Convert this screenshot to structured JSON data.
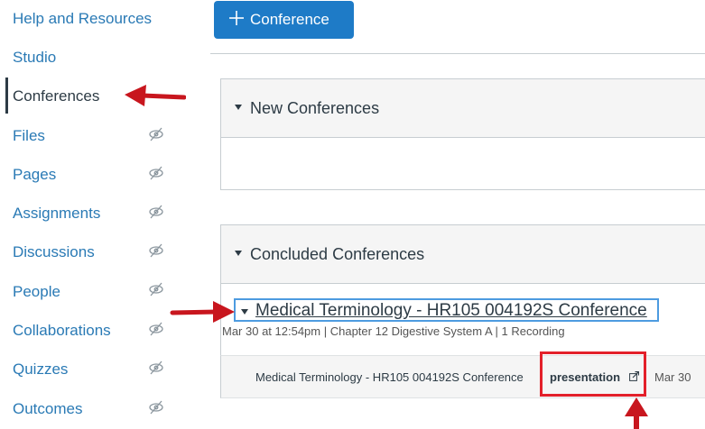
{
  "sidebar": {
    "items": [
      {
        "label": "Help and Resources",
        "hidden": false
      },
      {
        "label": "Studio",
        "hidden": false
      },
      {
        "label": "Conferences",
        "hidden": false,
        "active": true
      },
      {
        "label": "Files",
        "hidden": true
      },
      {
        "label": "Pages",
        "hidden": true
      },
      {
        "label": "Assignments",
        "hidden": true
      },
      {
        "label": "Discussions",
        "hidden": true
      },
      {
        "label": "People",
        "hidden": true
      },
      {
        "label": "Collaborations",
        "hidden": true
      },
      {
        "label": "Quizzes",
        "hidden": true
      },
      {
        "label": "Outcomes",
        "hidden": true
      }
    ]
  },
  "toolbar": {
    "add_label": "Conference"
  },
  "new_section": {
    "title": "New Conferences"
  },
  "concluded_section": {
    "title": "Concluded Conferences"
  },
  "conference": {
    "title": "Medical Terminology - HR105 004192S Conference",
    "meta": "Mar 30 at 12:54pm  |  Chapter 12 Digestive System A  |  1 Recording",
    "recording": {
      "name": "Medical Terminology - HR105 004192S Conference",
      "link": "presentation",
      "date": "Mar 30"
    }
  },
  "colors": {
    "link": "#2a7ab5",
    "button": "#1e7bc7",
    "annotation": "#c8161e"
  }
}
